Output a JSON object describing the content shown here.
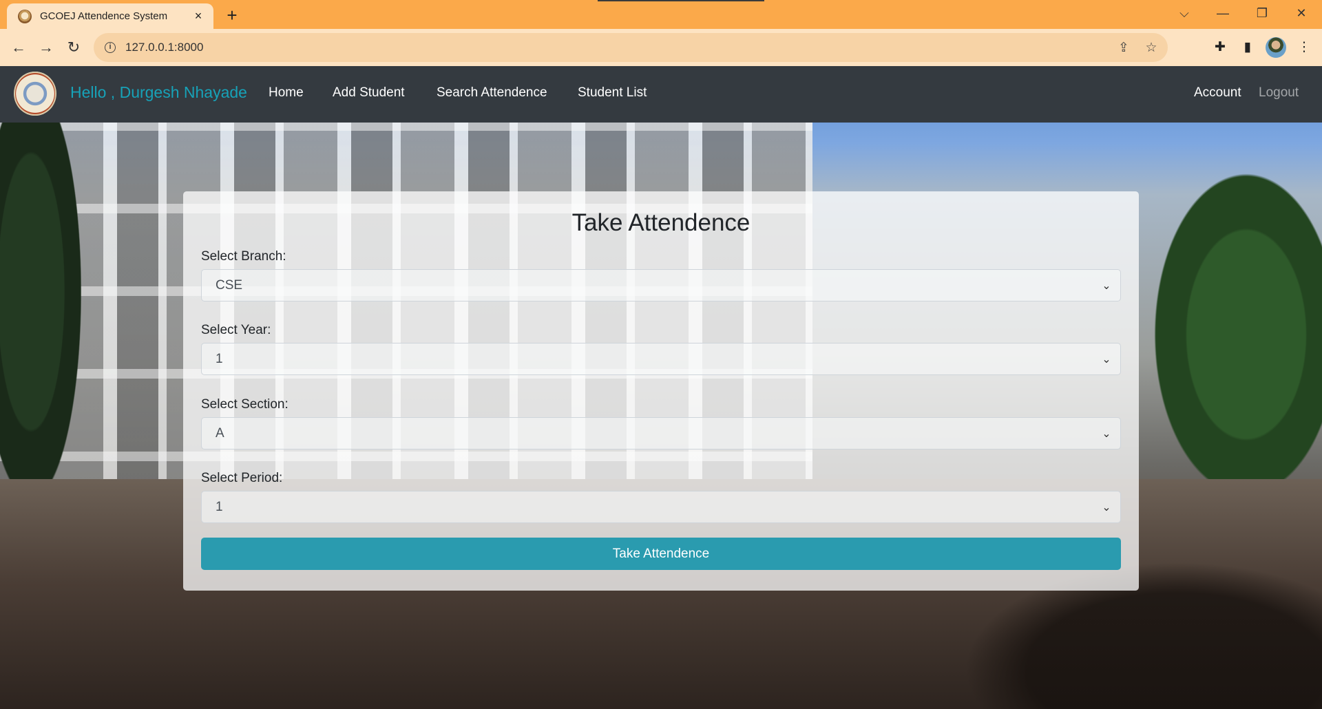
{
  "browser": {
    "tab_title": "GCOEJ Attendence System",
    "url": "127.0.0.1:8000",
    "icons": {
      "tab_close": "×",
      "new_tab": "+",
      "tab_search": "⌵",
      "minimize": "—",
      "restore": "❐",
      "close": "✕",
      "back": "←",
      "forward": "→",
      "reload": "↻",
      "share": "⇪",
      "bookmark": "☆",
      "extensions": "✚",
      "side_panel": "▮",
      "menu": "⋮",
      "info": "i"
    }
  },
  "navbar": {
    "greeting": "Hello , Durgesh Nhayade",
    "links": [
      "Home",
      "Add Student",
      "Search Attendence",
      "Student List"
    ],
    "account": "Account",
    "logout": "Logout"
  },
  "form": {
    "title": "Take Attendence",
    "fields": [
      {
        "label": "Select Branch:",
        "value": "CSE"
      },
      {
        "label": "Select Year:",
        "value": "1"
      },
      {
        "label": "Select Section:",
        "value": "A"
      },
      {
        "label": "Select Period:",
        "value": "1"
      }
    ],
    "chevron": "⌄",
    "submit_label": "Take Attendence",
    "accent_color": "#2a9baf"
  }
}
